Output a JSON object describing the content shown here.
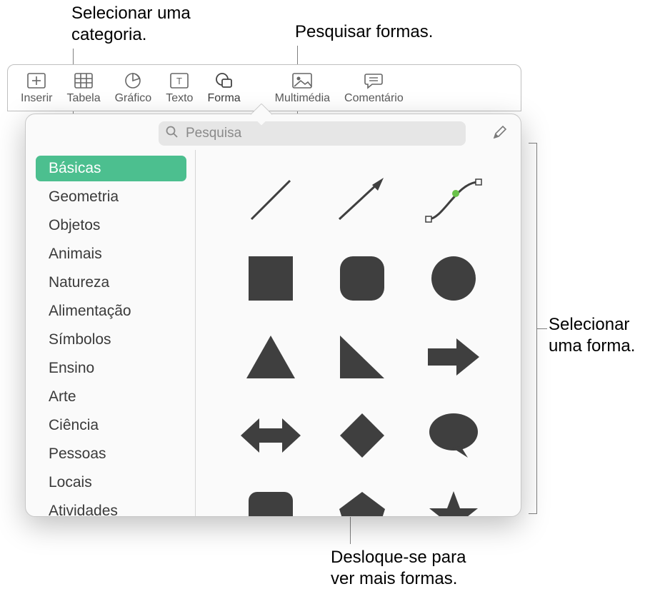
{
  "callouts": {
    "category": "Selecionar uma\ncategoria.",
    "search": "Pesquisar formas.",
    "select_shape": "Selecionar\numa forma.",
    "scroll_more": "Desloque-se para\nver mais formas."
  },
  "toolbar": {
    "items": [
      {
        "label": "Inserir",
        "icon": "insert-icon"
      },
      {
        "label": "Tabela",
        "icon": "table-icon"
      },
      {
        "label": "Gráfico",
        "icon": "chart-icon"
      },
      {
        "label": "Texto",
        "icon": "text-icon"
      },
      {
        "label": "Forma",
        "icon": "shape-icon",
        "selected": true
      },
      {
        "label": "Multimédia",
        "icon": "media-icon"
      },
      {
        "label": "Comentário",
        "icon": "comment-icon"
      }
    ]
  },
  "search": {
    "placeholder": "Pesquisa"
  },
  "sidebar": {
    "items": [
      {
        "label": "Básicas",
        "selected": true
      },
      {
        "label": "Geometria"
      },
      {
        "label": "Objetos"
      },
      {
        "label": "Animais"
      },
      {
        "label": "Natureza"
      },
      {
        "label": "Alimentação"
      },
      {
        "label": "Símbolos"
      },
      {
        "label": "Ensino"
      },
      {
        "label": "Arte"
      },
      {
        "label": "Ciência"
      },
      {
        "label": "Pessoas"
      },
      {
        "label": "Locais"
      },
      {
        "label": "Atividades"
      }
    ]
  },
  "shapes": [
    "line",
    "arrow-line",
    "bezier",
    "square",
    "rounded-square",
    "circle",
    "triangle",
    "right-triangle",
    "arrow-right",
    "arrow-bidir",
    "diamond",
    "speech-bubble",
    "callout-rect",
    "pentagon",
    "star"
  ]
}
